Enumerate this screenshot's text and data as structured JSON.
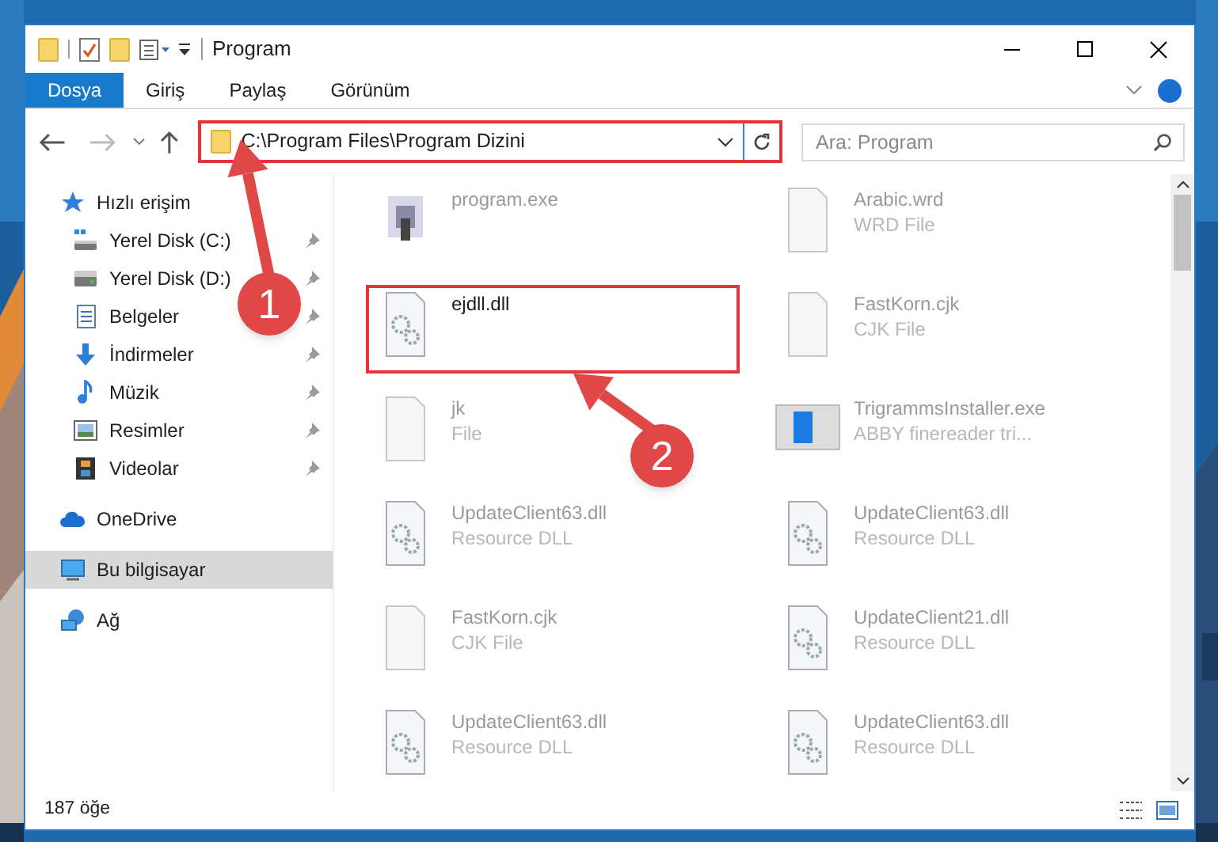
{
  "window": {
    "title": "Program"
  },
  "ribbon_tabs": [
    {
      "label": "Dosya",
      "selected": true
    },
    {
      "label": "Giriş",
      "selected": false
    },
    {
      "label": "Paylaş",
      "selected": false
    },
    {
      "label": "Görünüm",
      "selected": false
    }
  ],
  "address": {
    "path": "C:\\Program Files\\Program Dizini",
    "highlighted": true
  },
  "search": {
    "placeholder": "Ara: Program"
  },
  "sidebar": [
    {
      "label": "Hızlı erişim",
      "kind": "star",
      "selected": false,
      "children": [
        {
          "label": "Yerel Disk (C:)",
          "kind": "drive_c",
          "pinned": true,
          "selected": false
        },
        {
          "label": "Yerel Disk (D:)",
          "kind": "drive",
          "pinned": true,
          "selected": false
        },
        {
          "label": "Belgeler",
          "kind": "documents",
          "pinned": true,
          "selected": false
        },
        {
          "label": "İndirmeler",
          "kind": "downloads",
          "pinned": true,
          "selected": false
        },
        {
          "label": "Müzik",
          "kind": "music",
          "pinned": true,
          "selected": false
        },
        {
          "label": "Resimler",
          "kind": "pictures",
          "pinned": true,
          "selected": false
        },
        {
          "label": "Videolar",
          "kind": "videos",
          "pinned": true,
          "selected": false
        }
      ]
    },
    {
      "label": "OneDrive",
      "kind": "cloud",
      "selected": false
    },
    {
      "label": "Bu bilgisayar",
      "kind": "computer",
      "selected": true
    },
    {
      "label": "Ağ",
      "kind": "network",
      "selected": false
    }
  ],
  "files": [
    {
      "name": "program.exe",
      "kind": "exe",
      "highlighted": false
    },
    {
      "name": "Arabic.wrd",
      "type": "WRD File",
      "kind": "doc",
      "highlighted": false
    },
    {
      "name": "ejdll.dll",
      "kind": "dll",
      "highlighted": true
    },
    {
      "name": "FastKorn.cjk",
      "type": "CJK File",
      "kind": "doc",
      "highlighted": false
    },
    {
      "name": "jk",
      "type": "File",
      "kind": "doc",
      "highlighted": false
    },
    {
      "name": "TrigrammsInstaller.exe",
      "type": "ABBY finereader tri...",
      "kind": "installer",
      "highlighted": false
    },
    {
      "name": "UpdateClient63.dll",
      "type": "Resource DLL",
      "kind": "dll",
      "highlighted": false
    },
    {
      "name": "UpdateClient63.dll",
      "type": "Resource DLL",
      "kind": "dll",
      "highlighted": false
    },
    {
      "name": "FastKorn.cjk",
      "type": "CJK File",
      "kind": "doc",
      "highlighted": false
    },
    {
      "name": "UpdateClient21.dll",
      "type": "Resource DLL",
      "kind": "dll",
      "highlighted": false
    },
    {
      "name": "UpdateClient63.dll",
      "type": "Resource DLL",
      "kind": "dll",
      "highlighted": false
    },
    {
      "name": "UpdateClient63.dll",
      "type": "Resource DLL",
      "kind": "dll",
      "highlighted": false
    }
  ],
  "status_bar": {
    "count": "187 öğe"
  },
  "callouts": [
    {
      "number": "1"
    },
    {
      "number": "2"
    }
  ]
}
